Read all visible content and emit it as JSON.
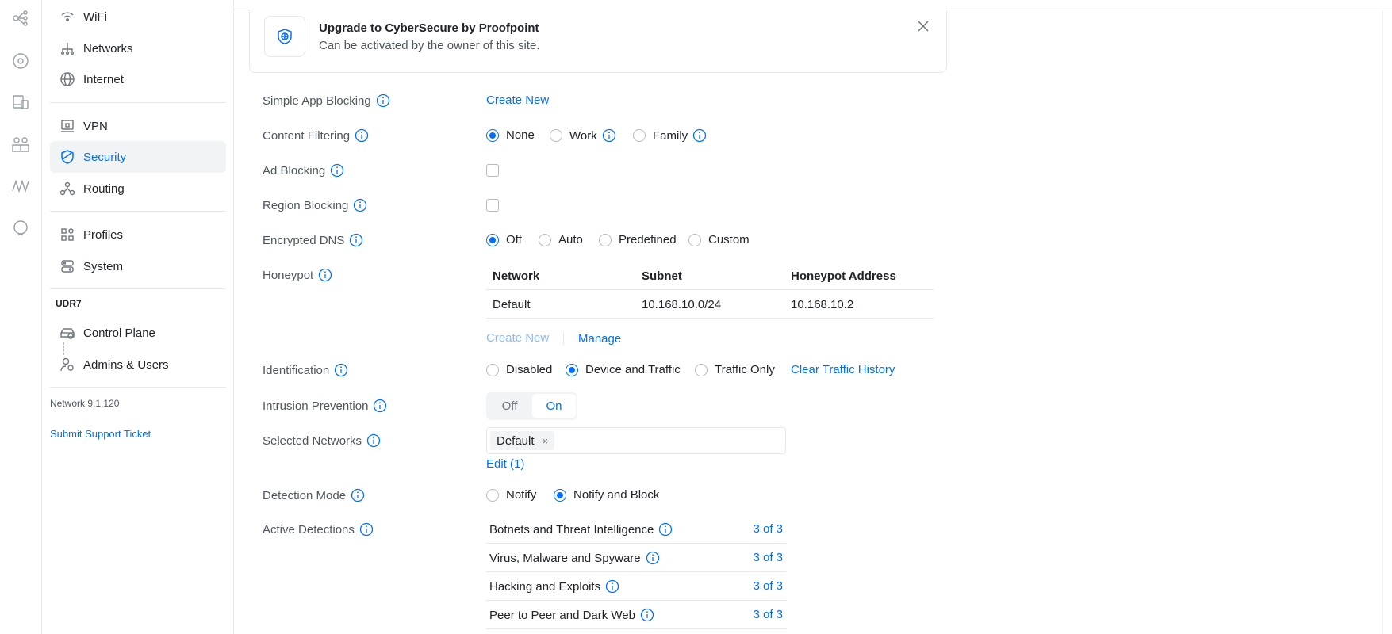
{
  "sidebar": {
    "items": [
      {
        "label": "WiFi"
      },
      {
        "label": "Networks"
      },
      {
        "label": "Internet"
      },
      {
        "label": "VPN"
      },
      {
        "label": "Security"
      },
      {
        "label": "Routing"
      },
      {
        "label": "Profiles"
      },
      {
        "label": "System"
      }
    ],
    "device_label": "UDR7",
    "device_items": [
      {
        "label": "Control Plane"
      },
      {
        "label": "Admins & Users"
      }
    ],
    "version": "Network 9.1.120",
    "support_link": "Submit Support Ticket"
  },
  "banner": {
    "title": "Upgrade to CyberSecure by Proofpoint",
    "subtitle": "Can be activated by the owner of this site."
  },
  "settings": {
    "simple_app_blocking": {
      "label": "Simple App Blocking",
      "action": "Create New"
    },
    "content_filtering": {
      "label": "Content Filtering",
      "options": [
        "None",
        "Work",
        "Family"
      ],
      "selected": "None"
    },
    "ad_blocking": {
      "label": "Ad Blocking",
      "checked": false
    },
    "region_blocking": {
      "label": "Region Blocking",
      "checked": false
    },
    "encrypted_dns": {
      "label": "Encrypted DNS",
      "options": [
        "Off",
        "Auto",
        "Predefined",
        "Custom"
      ],
      "selected": "Off"
    },
    "honeypot": {
      "label": "Honeypot",
      "columns": [
        "Network",
        "Subnet",
        "Honeypot Address"
      ],
      "rows": [
        [
          "Default",
          "10.168.10.0/24",
          "10.168.10.2"
        ]
      ],
      "create_new": "Create New",
      "manage": "Manage"
    },
    "identification": {
      "label": "Identification",
      "options": [
        "Disabled",
        "Device and Traffic",
        "Traffic Only"
      ],
      "selected": "Device and Traffic",
      "action": "Clear Traffic History"
    },
    "intrusion_prevention": {
      "label": "Intrusion Prevention",
      "off": "Off",
      "on": "On",
      "selected": "On"
    },
    "selected_networks": {
      "label": "Selected Networks",
      "chips": [
        "Default"
      ],
      "chip_remove": "×",
      "edit": "Edit (1)"
    },
    "detection_mode": {
      "label": "Detection Mode",
      "options": [
        "Notify",
        "Notify and Block"
      ],
      "selected": "Notify and Block"
    },
    "active_detections": {
      "label": "Active Detections",
      "items": [
        {
          "name": "Botnets and Threat Intelligence",
          "count": "3 of 3"
        },
        {
          "name": "Virus, Malware and Spyware",
          "count": "3 of 3"
        },
        {
          "name": "Hacking and Exploits",
          "count": "3 of 3"
        },
        {
          "name": "Peer to Peer and Dark Web",
          "count": "3 of 3"
        }
      ]
    }
  },
  "colors": {
    "accent": "#006fff",
    "text": "#212327",
    "muted": "#50565e",
    "border": "#e6e8eb"
  }
}
